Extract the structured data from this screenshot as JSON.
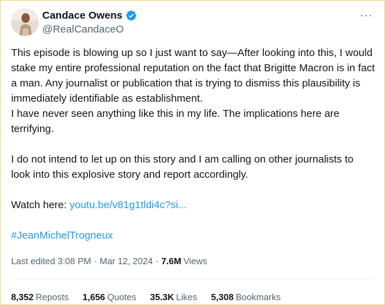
{
  "author": {
    "name": "Candace Owens",
    "handle": "@RealCandaceO",
    "verified": true
  },
  "more_label": "···",
  "tweet": {
    "p1": "This episode is blowing up so I just want to say—After looking into this, I would stake my entire professional reputation on the fact that Brigitte Macron is in fact a man. Any journalist or publication that is trying to dismiss this plausibility is immediately identifiable as establishment.",
    "p2": "I have never seen anything like this in my life. The implications here are terrifying.",
    "p3": "I do not intend to let up on this story and I am calling on other journalists to look into this explosive story and report accordingly.",
    "watch_prefix": "Watch here: ",
    "watch_link": "youtu.be/v81g1tldi4c?si...",
    "hashtag": "#JeanMichelTrogneux"
  },
  "meta": {
    "edited": "Last edited 3:08 PM",
    "date": "Mar 12, 2024",
    "views_count": "7.6M",
    "views_label": "Views"
  },
  "stats": [
    {
      "count": "8,352",
      "label": "Reposts"
    },
    {
      "count": "1,656",
      "label": "Quotes"
    },
    {
      "count": "35.3K",
      "label": "Likes"
    },
    {
      "count": "5,308",
      "label": "Bookmarks"
    }
  ],
  "colors": {
    "accent": "#1d9bf0",
    "text": "#0f1419",
    "muted": "#536471",
    "frame_border": "#f0d98c"
  },
  "icons": {
    "verified": "verified-badge-icon",
    "more": "more-options-icon"
  }
}
